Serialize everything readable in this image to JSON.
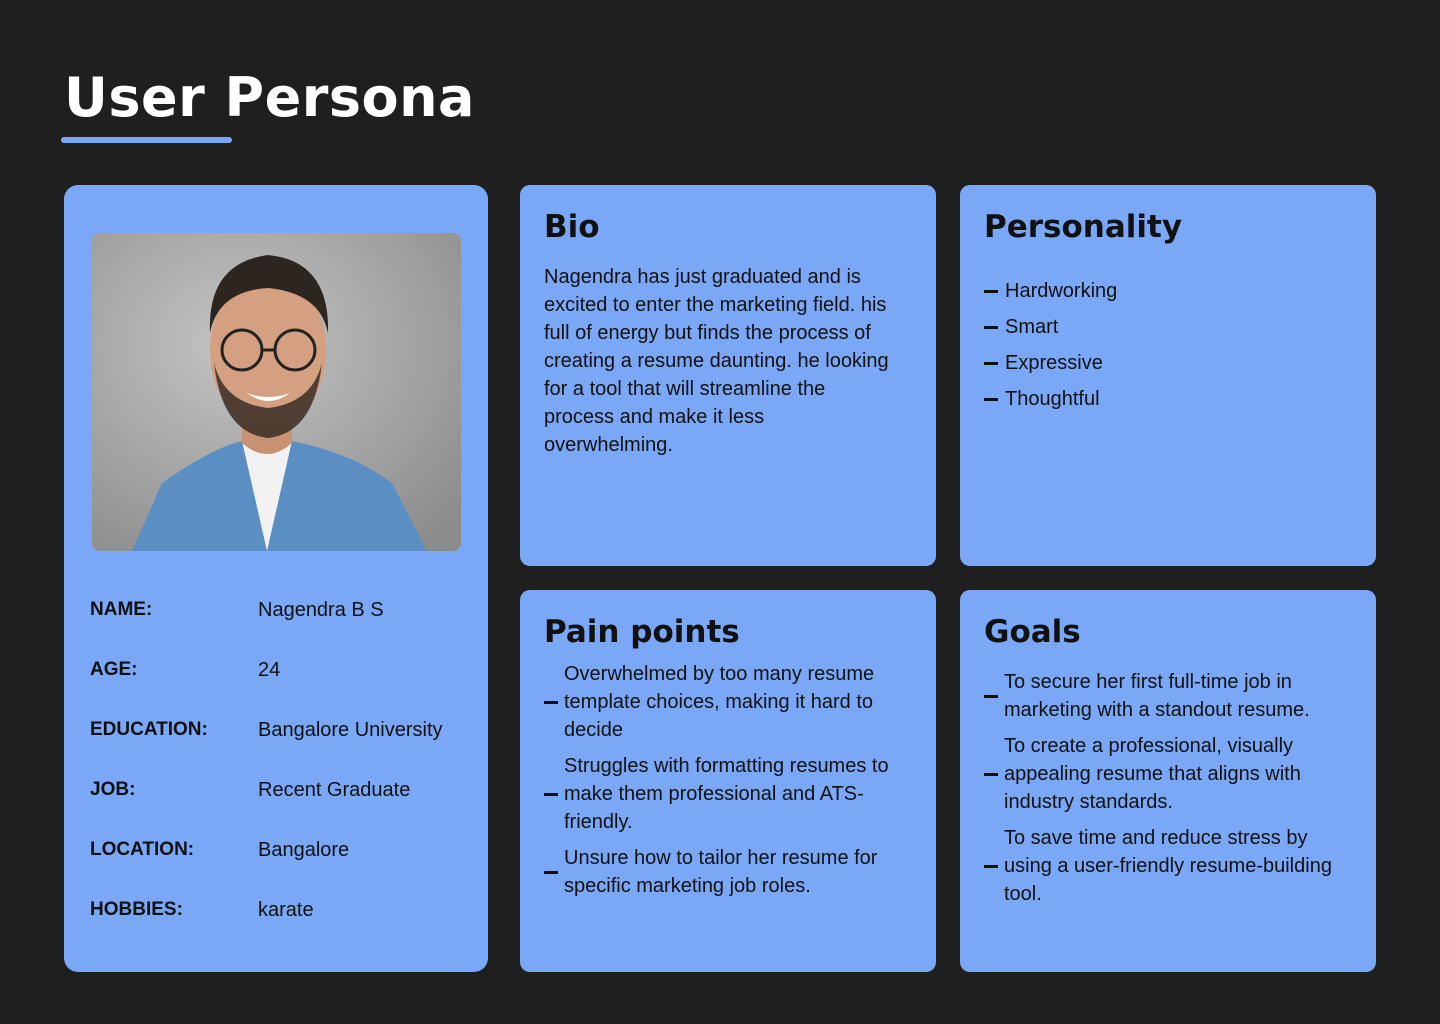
{
  "header": {
    "title": "User Persona"
  },
  "profile": {
    "photo_alt": "",
    "fields": [
      {
        "label": "NAME:",
        "value": "Nagendra B S"
      },
      {
        "label": "AGE:",
        "value": "24"
      },
      {
        "label": "EDUCATION:",
        "value": "Bangalore University"
      },
      {
        "label": "JOB:",
        "value": "Recent Graduate"
      },
      {
        "label": "LOCATION:",
        "value": "Bangalore"
      },
      {
        "label": "HOBBIES:",
        "value": "karate"
      }
    ]
  },
  "bio": {
    "title": "Bio",
    "text": "Nagendra has just graduated and is excited to enter the marketing field. his full of energy but finds the process of creating a resume daunting. he looking for a tool that will streamline the process and make it less overwhelming."
  },
  "personality": {
    "title": "Personality",
    "traits": [
      "Hardworking",
      "Smart",
      "Expressive",
      "Thoughtful"
    ]
  },
  "pain_points": {
    "title": "Pain points",
    "items": [
      "Overwhelmed by too many resume template choices, making it hard to decide",
      "Struggles with formatting resumes to make them professional and ATS-friendly.",
      "Unsure how to tailor her resume for specific marketing job roles."
    ]
  },
  "goals": {
    "title": "Goals",
    "items": [
      "To secure her first full-time job in marketing with a standout resume.",
      "To create a professional, visually appealing resume that aligns with industry standards.",
      "To save time and reduce stress by using a user-friendly resume-building tool."
    ]
  },
  "colors": {
    "background": "#1f1f1f",
    "card": "#7aa8f7",
    "accent": "#7aa8f7",
    "text": "#111111",
    "title": "#ffffff"
  }
}
